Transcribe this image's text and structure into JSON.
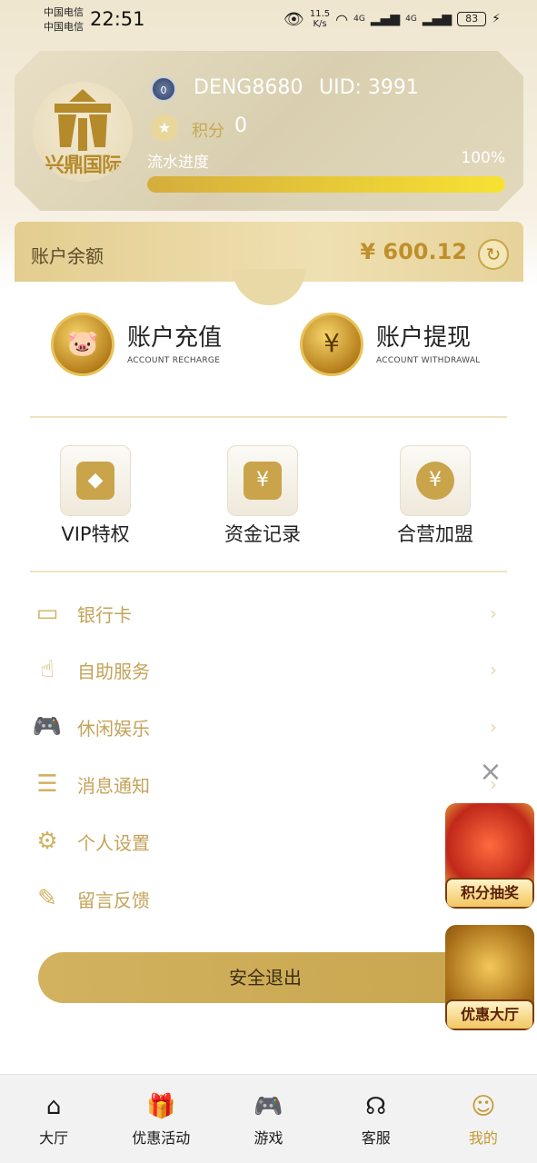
{
  "status_bar": {
    "carrier1": "中国电信",
    "carrier2": "中国电信",
    "time": "22:51",
    "net_speed": "11.5\nK/s",
    "sig1": "4G",
    "sig2": "4G",
    "battery": "83"
  },
  "profile": {
    "avatar_text": "兴鼎国际",
    "vip_level": "0",
    "username": "DENG8680",
    "uid": "UID: 3991",
    "points_label": "积分",
    "points_value": "0",
    "progress_label": "流水进度",
    "progress_percent_text": "100%",
    "progress_value": 1.0
  },
  "balance": {
    "label": "账户余额",
    "amount": "¥ 600.12"
  },
  "actions": {
    "recharge_title": "账户充值",
    "recharge_sub": "ACCOUNT RECHARGE",
    "withdraw_title": "账户提现",
    "withdraw_sub": "ACCOUNT WITHDRAWAL"
  },
  "shortcuts": {
    "vip": "VIP特权",
    "records": "资金记录",
    "franchise": "合营加盟"
  },
  "menu": {
    "bank_card": "银行卡",
    "self_service": "自助服务",
    "leisure": "休闲娱乐",
    "messages": "消息通知",
    "settings": "个人设置",
    "feedback": "留言反馈"
  },
  "logout_label": "安全退出",
  "promos": {
    "lottery": "积分抽奖",
    "hall": "优惠大厅"
  },
  "nav": {
    "home": "大厅",
    "promotions": "优惠活动",
    "games": "游戏",
    "support": "客服",
    "mine": "我的"
  },
  "colors": {
    "accent_gold": "#c49a32",
    "menu_text": "#c4a35a",
    "progress_start": "#d5ad3d",
    "progress_end": "#f7e233"
  },
  "icons": {
    "home": "house-icon",
    "promotions": "gift-icon",
    "games": "gamepad-icon",
    "support": "headset-icon",
    "mine": "user-icon"
  }
}
